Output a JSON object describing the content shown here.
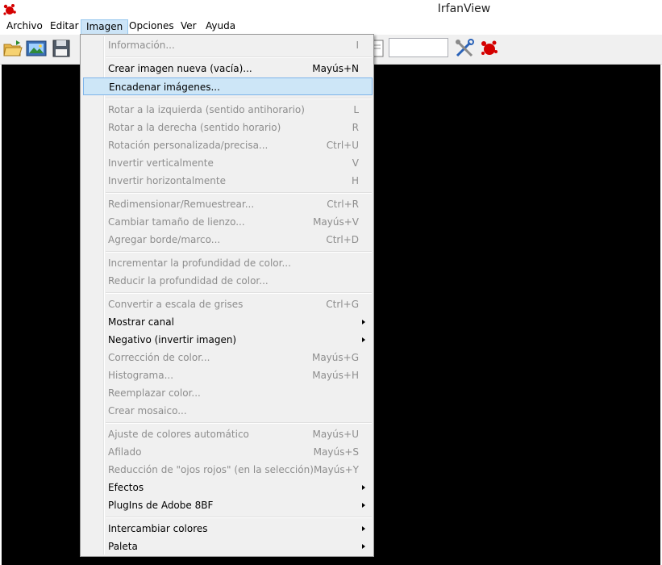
{
  "window": {
    "title": "IrfanView"
  },
  "menubar": {
    "items": [
      {
        "label": "Archivo"
      },
      {
        "label": "Editar"
      },
      {
        "label": "Imagen"
      },
      {
        "label": "Opciones"
      },
      {
        "label": "Ver"
      },
      {
        "label": "Ayuda"
      }
    ]
  },
  "toolbar": {
    "icons": [
      "open-folder-icon",
      "slideshow-icon",
      "save-icon",
      "tools-icon",
      "irfanview-logo-icon"
    ],
    "zoom_input_value": ""
  },
  "menu": {
    "items": [
      {
        "label": "Información...",
        "shortcut": "I",
        "disabled": true
      },
      {
        "label": "Crear imagen nueva (vacía)...",
        "shortcut": "Mayús+N",
        "disabled": false
      },
      {
        "label": "Encadenar imágenes...",
        "shortcut": "",
        "disabled": false,
        "highlighted": true
      },
      {
        "label": "Rotar a la izquierda (sentido antihorario)",
        "shortcut": "L",
        "disabled": true
      },
      {
        "label": "Rotar a la derecha (sentido horario)",
        "shortcut": "R",
        "disabled": true
      },
      {
        "label": "Rotación personalizada/precisa...",
        "shortcut": "Ctrl+U",
        "disabled": true
      },
      {
        "label": "Invertir verticalmente",
        "shortcut": "V",
        "disabled": true
      },
      {
        "label": "Invertir horizontalmente",
        "shortcut": "H",
        "disabled": true
      },
      {
        "label": "Redimensionar/Remuestrear...",
        "shortcut": "Ctrl+R",
        "disabled": true
      },
      {
        "label": "Cambiar tamaño de lienzo...",
        "shortcut": "Mayús+V",
        "disabled": true
      },
      {
        "label": "Agregar borde/marco...",
        "shortcut": "Ctrl+D",
        "disabled": true
      },
      {
        "label": "Incrementar la profundidad de color...",
        "shortcut": "",
        "disabled": true
      },
      {
        "label": "Reducir la profundidad de color...",
        "shortcut": "",
        "disabled": true
      },
      {
        "label": "Convertir a escala de grises",
        "shortcut": "Ctrl+G",
        "disabled": true
      },
      {
        "label": "Mostrar canal",
        "shortcut": "",
        "disabled": false,
        "submenu": true
      },
      {
        "label": "Negativo (invertir imagen)",
        "shortcut": "",
        "disabled": false,
        "submenu": true
      },
      {
        "label": "Corrección de color...",
        "shortcut": "Mayús+G",
        "disabled": true
      },
      {
        "label": "Histograma...",
        "shortcut": "Mayús+H",
        "disabled": true
      },
      {
        "label": "Reemplazar color...",
        "shortcut": "",
        "disabled": true
      },
      {
        "label": "Crear mosaico...",
        "shortcut": "",
        "disabled": true
      },
      {
        "label": "Ajuste de colores automático",
        "shortcut": "Mayús+U",
        "disabled": true
      },
      {
        "label": "Afilado",
        "shortcut": "Mayús+S",
        "disabled": true
      },
      {
        "label": "Reducción de \"ojos rojos\" (en la selección)",
        "shortcut": "Mayús+Y",
        "disabled": true
      },
      {
        "label": "Efectos",
        "shortcut": "",
        "disabled": false,
        "submenu": true
      },
      {
        "label": "PlugIns de Adobe 8BF",
        "shortcut": "",
        "disabled": false,
        "submenu": true
      },
      {
        "label": "Intercambiar colores",
        "shortcut": "",
        "disabled": false,
        "submenu": true
      },
      {
        "label": "Paleta",
        "shortcut": "",
        "disabled": false,
        "submenu": true
      }
    ]
  },
  "colors": {
    "accent": "#cde6f7",
    "disabled_text": "#8d8d8d",
    "canvas": "#000000"
  }
}
